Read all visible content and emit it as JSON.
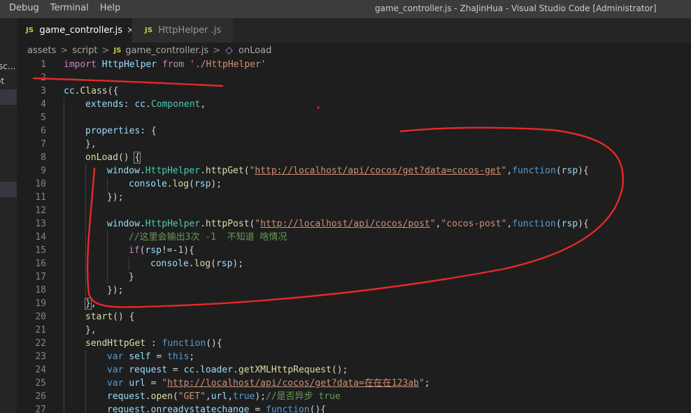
{
  "menu": {
    "items": [
      "Debug",
      "Terminal",
      "Help"
    ]
  },
  "window": {
    "title": "game_controller.js - ZhaJinHua - Visual Studio Code [Administrator]"
  },
  "sidebar": {
    "visible_fragments": [
      "\\sc...",
      "ot"
    ]
  },
  "tabs": [
    {
      "icon": "JS",
      "label": "game_controller.js",
      "close": "×",
      "active": true
    },
    {
      "icon": "JS",
      "label": "HttpHelper .js",
      "active": false
    }
  ],
  "breadcrumb": {
    "segments": [
      "assets",
      "script",
      "game_controller.js",
      "onLoad"
    ],
    "file_icon": "JS",
    "separator": ">"
  },
  "colors": {
    "keyword": "#569cd6",
    "control": "#c586c0",
    "string": "#ce9178",
    "variable": "#9cdcfe",
    "function": "#dcdcaa",
    "class": "#4ec9b0",
    "number": "#b5cea8",
    "comment": "#6a9955",
    "annotation": "#e8282a"
  },
  "code": {
    "lines": [
      {
        "n": "1",
        "indent": 0,
        "tokens": [
          [
            "ctl",
            "import"
          ],
          [
            "p",
            " "
          ],
          [
            "var",
            "HttpHelper"
          ],
          [
            "p",
            " "
          ],
          [
            "ctl",
            "from"
          ],
          [
            "p",
            " "
          ],
          [
            "str",
            "'./HttpHelper'"
          ]
        ]
      },
      {
        "n": "2",
        "indent": 0,
        "tokens": []
      },
      {
        "n": "3",
        "indent": 0,
        "tokens": [
          [
            "var",
            "cc"
          ],
          [
            "p",
            "."
          ],
          [
            "fn",
            "Class"
          ],
          [
            "p",
            "({"
          ]
        ]
      },
      {
        "n": "4",
        "indent": 1,
        "tokens": [
          [
            "var",
            "extends"
          ],
          [
            "p",
            ": "
          ],
          [
            "var",
            "cc"
          ],
          [
            "p",
            "."
          ],
          [
            "cls",
            "Component"
          ],
          [
            "p",
            ","
          ]
        ]
      },
      {
        "n": "5",
        "indent": 1,
        "tokens": []
      },
      {
        "n": "6",
        "indent": 1,
        "tokens": [
          [
            "var",
            "properties"
          ],
          [
            "p",
            ": {"
          ]
        ]
      },
      {
        "n": "7",
        "indent": 1,
        "tokens": [
          [
            "p",
            "},"
          ]
        ]
      },
      {
        "n": "8",
        "indent": 1,
        "tokens": [
          [
            "fn",
            "onLoad"
          ],
          [
            "p",
            "() "
          ],
          [
            "hl",
            "{"
          ]
        ]
      },
      {
        "n": "9",
        "indent": 2,
        "tokens": [
          [
            "var",
            "window"
          ],
          [
            "p",
            "."
          ],
          [
            "cls",
            "HttpHelper"
          ],
          [
            "p",
            "."
          ],
          [
            "fn",
            "httpGet"
          ],
          [
            "p",
            "("
          ],
          [
            "str",
            "\""
          ],
          [
            "url",
            "http://localhost/api/cocos/get?data=cocos-get"
          ],
          [
            "str",
            "\""
          ],
          [
            "p",
            ","
          ],
          [
            "kw",
            "function"
          ],
          [
            "p",
            "("
          ],
          [
            "var",
            "rsp"
          ],
          [
            "p",
            "){"
          ]
        ]
      },
      {
        "n": "10",
        "indent": 3,
        "tokens": [
          [
            "var",
            "console"
          ],
          [
            "p",
            "."
          ],
          [
            "fn",
            "log"
          ],
          [
            "p",
            "("
          ],
          [
            "var",
            "rsp"
          ],
          [
            "p",
            ");"
          ]
        ]
      },
      {
        "n": "11",
        "indent": 2,
        "tokens": [
          [
            "p",
            "});"
          ]
        ]
      },
      {
        "n": "12",
        "indent": 2,
        "tokens": []
      },
      {
        "n": "13",
        "indent": 2,
        "tokens": [
          [
            "var",
            "window"
          ],
          [
            "p",
            "."
          ],
          [
            "cls",
            "HttpHelper"
          ],
          [
            "p",
            "."
          ],
          [
            "fn",
            "httpPost"
          ],
          [
            "p",
            "("
          ],
          [
            "str",
            "\""
          ],
          [
            "url",
            "http://localhost/api/cocos/post"
          ],
          [
            "str",
            "\""
          ],
          [
            "p",
            ","
          ],
          [
            "str",
            "\"cocos-post\""
          ],
          [
            "p",
            ","
          ],
          [
            "kw",
            "function"
          ],
          [
            "p",
            "("
          ],
          [
            "var",
            "rsp"
          ],
          [
            "p",
            "){"
          ]
        ]
      },
      {
        "n": "14",
        "indent": 3,
        "tokens": [
          [
            "cm",
            "//这里会输出3次 -1  不知道 啥情况"
          ]
        ]
      },
      {
        "n": "15",
        "indent": 3,
        "tokens": [
          [
            "ctl",
            "if"
          ],
          [
            "p",
            "("
          ],
          [
            "var",
            "rsp"
          ],
          [
            "p",
            "!=-"
          ],
          [
            "num",
            "1"
          ],
          [
            "p",
            "){"
          ]
        ]
      },
      {
        "n": "16",
        "indent": 4,
        "tokens": [
          [
            "var",
            "console"
          ],
          [
            "p",
            "."
          ],
          [
            "fn",
            "log"
          ],
          [
            "p",
            "("
          ],
          [
            "var",
            "rsp"
          ],
          [
            "p",
            ");"
          ]
        ]
      },
      {
        "n": "17",
        "indent": 3,
        "tokens": [
          [
            "p",
            "}"
          ]
        ]
      },
      {
        "n": "18",
        "indent": 2,
        "tokens": [
          [
            "p",
            "});"
          ]
        ]
      },
      {
        "n": "19",
        "indent": 1,
        "tokens": [
          [
            "hl",
            "}"
          ],
          [
            "p",
            ","
          ]
        ]
      },
      {
        "n": "20",
        "indent": 1,
        "tokens": [
          [
            "fn",
            "start"
          ],
          [
            "p",
            "() {"
          ]
        ]
      },
      {
        "n": "21",
        "indent": 1,
        "tokens": [
          [
            "p",
            "},"
          ]
        ]
      },
      {
        "n": "22",
        "indent": 1,
        "tokens": [
          [
            "fn",
            "sendHttpGet"
          ],
          [
            "p",
            " : "
          ],
          [
            "kw",
            "function"
          ],
          [
            "p",
            "(){"
          ]
        ]
      },
      {
        "n": "23",
        "indent": 2,
        "tokens": [
          [
            "kw",
            "var"
          ],
          [
            "p",
            " "
          ],
          [
            "var",
            "self"
          ],
          [
            "p",
            " = "
          ],
          [
            "kw",
            "this"
          ],
          [
            "p",
            ";"
          ]
        ]
      },
      {
        "n": "24",
        "indent": 2,
        "tokens": [
          [
            "kw",
            "var"
          ],
          [
            "p",
            " "
          ],
          [
            "var",
            "request"
          ],
          [
            "p",
            " = "
          ],
          [
            "var",
            "cc"
          ],
          [
            "p",
            "."
          ],
          [
            "var",
            "loader"
          ],
          [
            "p",
            "."
          ],
          [
            "fn",
            "getXMLHttpRequest"
          ],
          [
            "p",
            "();"
          ]
        ]
      },
      {
        "n": "25",
        "indent": 2,
        "tokens": [
          [
            "kw",
            "var"
          ],
          [
            "p",
            " "
          ],
          [
            "var",
            "url"
          ],
          [
            "p",
            " = "
          ],
          [
            "str",
            "\""
          ],
          [
            "url",
            "http://localhost/api/cocos/get?data=在在在123ab"
          ],
          [
            "str",
            "\""
          ],
          [
            "p",
            ";"
          ]
        ]
      },
      {
        "n": "26",
        "indent": 2,
        "tokens": [
          [
            "var",
            "request"
          ],
          [
            "p",
            "."
          ],
          [
            "fn",
            "open"
          ],
          [
            "p",
            "("
          ],
          [
            "str",
            "\"GET\""
          ],
          [
            "p",
            ","
          ],
          [
            "var",
            "url"
          ],
          [
            "p",
            ","
          ],
          [
            "kw",
            "true"
          ],
          [
            "p",
            ");"
          ],
          [
            "cm",
            "//是否异步 true"
          ]
        ]
      },
      {
        "n": "27",
        "indent": 2,
        "tokens": [
          [
            "var",
            "request"
          ],
          [
            "p",
            "."
          ],
          [
            "var",
            "onreadystatechange"
          ],
          [
            "p",
            " = "
          ],
          [
            "kw",
            "function"
          ],
          [
            "p",
            "(){"
          ]
        ]
      }
    ]
  }
}
